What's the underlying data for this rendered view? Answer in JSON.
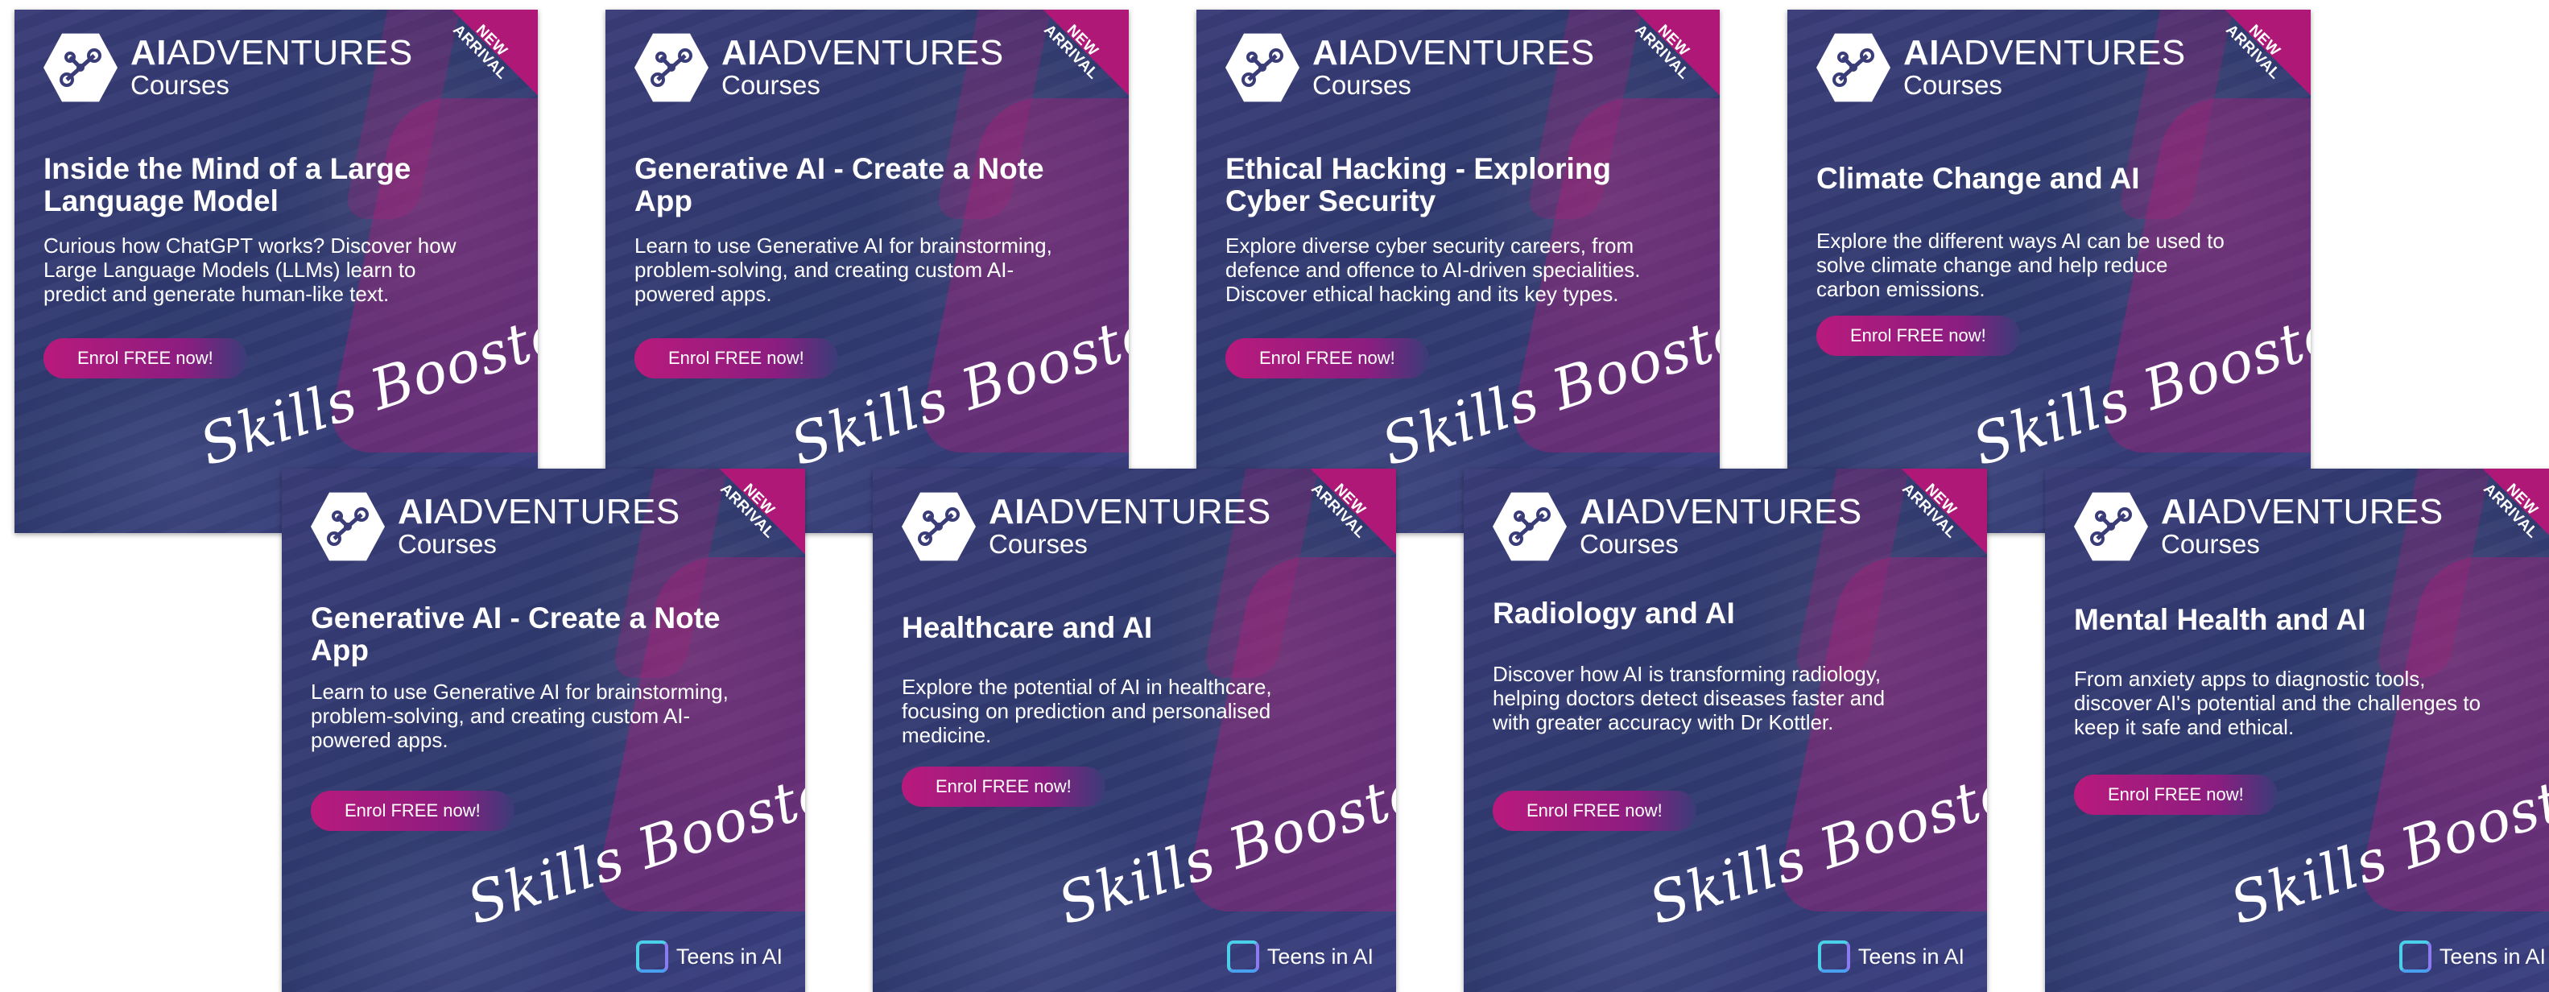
{
  "cards": [
    {
      "brand_bold": "AI",
      "brand_rest": "ADVENTURES",
      "courses": "Courses",
      "ribbon": "NEW ARRIVAL",
      "title": "Inside the Mind of a Large Language Model",
      "description": "Curious how ChatGPT works? Discover how Large Language Models (LLMs) learn to predict and generate human-like text.",
      "button": "Enrol FREE now!",
      "tagline": "Skills Booster!",
      "partner": ""
    },
    {
      "brand_bold": "AI",
      "brand_rest": "ADVENTURES",
      "courses": "Courses",
      "ribbon": "NEW ARRIVAL",
      "title": "Generative AI - Create a Note App",
      "description": "Learn to use Generative AI for brainstorming, problem-solving, and creating custom AI-powered apps.",
      "button": "Enrol FREE now!",
      "tagline": "Skills Booster!",
      "partner": ""
    },
    {
      "brand_bold": "AI",
      "brand_rest": "ADVENTURES",
      "courses": "Courses",
      "ribbon": "NEW ARRIVAL",
      "title": "Ethical Hacking - Exploring Cyber Security",
      "description": "Explore diverse cyber security careers, from defence and offence to AI-driven specialities. Discover ethical hacking and its key types.",
      "button": "Enrol FREE now!",
      "tagline": "Skills Booster!",
      "partner": ""
    },
    {
      "brand_bold": "AI",
      "brand_rest": "ADVENTURES",
      "courses": "Courses",
      "ribbon": "NEW ARRIVAL",
      "title": "Climate Change and AI",
      "description": "Explore the different ways AI can be used to solve climate change and help reduce carbon emissions.",
      "button": "Enrol FREE now!",
      "tagline": "Skills Booster!",
      "partner": ""
    },
    {
      "brand_bold": "AI",
      "brand_rest": "ADVENTURES",
      "courses": "Courses",
      "ribbon": "NEW ARRIVAL",
      "title": "Generative AI - Create a Note App",
      "description": "Learn to use Generative AI for brainstorming, problem-solving, and creating custom AI-powered apps.",
      "button": "Enrol FREE now!",
      "tagline": "Skills Booster!",
      "partner": "Teens in AI"
    },
    {
      "brand_bold": "AI",
      "brand_rest": "ADVENTURES",
      "courses": "Courses",
      "ribbon": "NEW ARRIVAL",
      "title": "Healthcare and AI",
      "description": "Explore the potential of AI in healthcare, focusing on prediction and personalised medicine.",
      "button": "Enrol FREE now!",
      "tagline": "Skills Booster!",
      "partner": "Teens in AI"
    },
    {
      "brand_bold": "AI",
      "brand_rest": "ADVENTURES",
      "courses": "Courses",
      "ribbon": "NEW ARRIVAL",
      "title": "Radiology and AI",
      "description": "Discover how AI is transforming radiology, helping doctors detect diseases faster and with greater accuracy with Dr Kottler.",
      "button": "Enrol FREE now!",
      "tagline": "Skills Booster!",
      "partner": "Teens in AI"
    },
    {
      "brand_bold": "AI",
      "brand_rest": "ADVENTURES",
      "courses": "Courses",
      "ribbon": "NEW ARRIVAL",
      "title": "Mental Health and AI",
      "description": "From anxiety apps to diagnostic tools, discover AI's potential and the challenges to keep it safe and ethical.",
      "button": "Enrol FREE now!",
      "tagline": "Skills Booster!",
      "partner": "Teens in AI"
    }
  ]
}
